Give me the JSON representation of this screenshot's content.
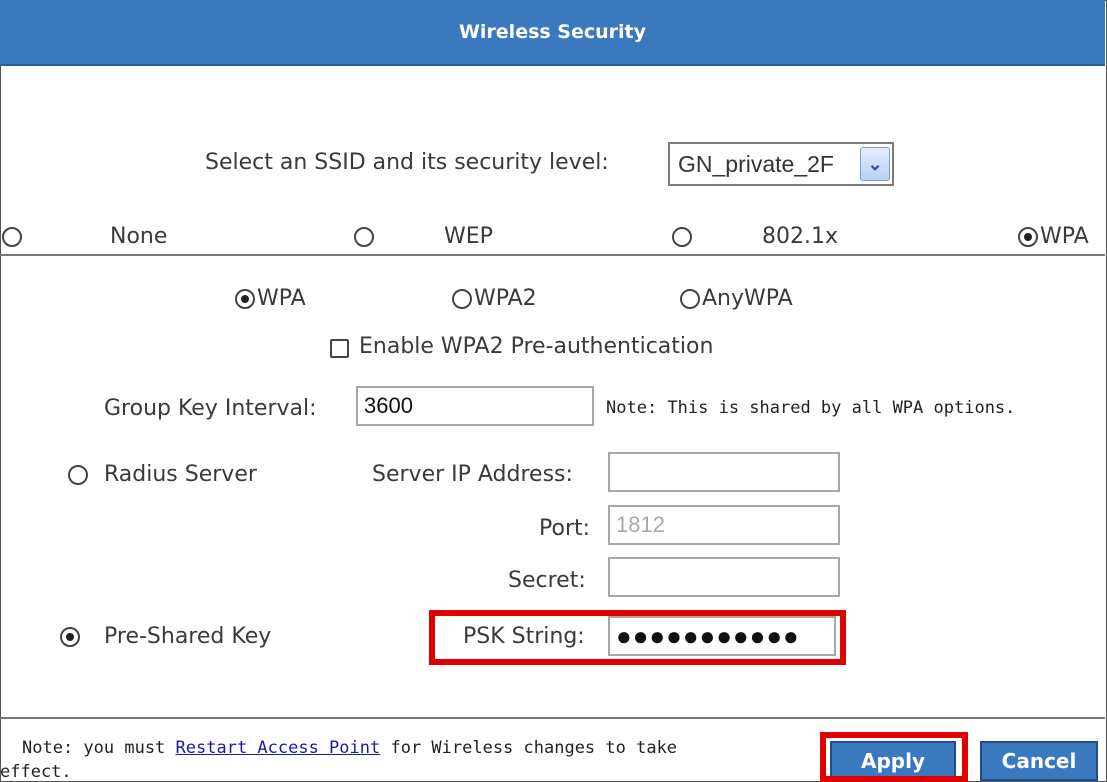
{
  "header": {
    "title": "Wireless Security"
  },
  "ssid": {
    "label": "Select an SSID and its security level:",
    "selected": "GN_private_2F",
    "arrow_icon": "chevron-down-icon"
  },
  "security_levels": [
    {
      "label": "None",
      "checked": false
    },
    {
      "label": "WEP",
      "checked": false
    },
    {
      "label": "802.1x",
      "checked": false
    },
    {
      "label": "WPA",
      "checked": true
    }
  ],
  "wpa_modes": [
    {
      "label": "WPA",
      "checked": true
    },
    {
      "label": "WPA2",
      "checked": false
    },
    {
      "label": "AnyWPA",
      "checked": false
    }
  ],
  "preauth": {
    "label": "Enable WPA2 Pre-authentication",
    "checked": false
  },
  "group_key": {
    "label": "Group Key Interval:",
    "value": "3600",
    "note": "Note: This is shared by all WPA options."
  },
  "radius": {
    "label": "Radius Server",
    "checked": false,
    "server_ip_label": "Server IP Address:",
    "server_ip_value": "",
    "port_label": "Port:",
    "port_value": "1812",
    "secret_label": "Secret:",
    "secret_value": ""
  },
  "psk": {
    "label": "Pre-Shared Key",
    "checked": true,
    "string_label": "PSK String:",
    "string_value": "●●●●●●●●●●●"
  },
  "footer": {
    "note_prefix": "Note: you must ",
    "note_link": "Restart Access Point",
    "note_suffix_line1": " for Wireless changes to take",
    "note_line2": "effect.",
    "apply_label": "Apply",
    "cancel_label": "Cancel"
  },
  "colors": {
    "header_bg": "#3a78c0",
    "highlight": "#e00000",
    "link": "#1a1aa6"
  }
}
